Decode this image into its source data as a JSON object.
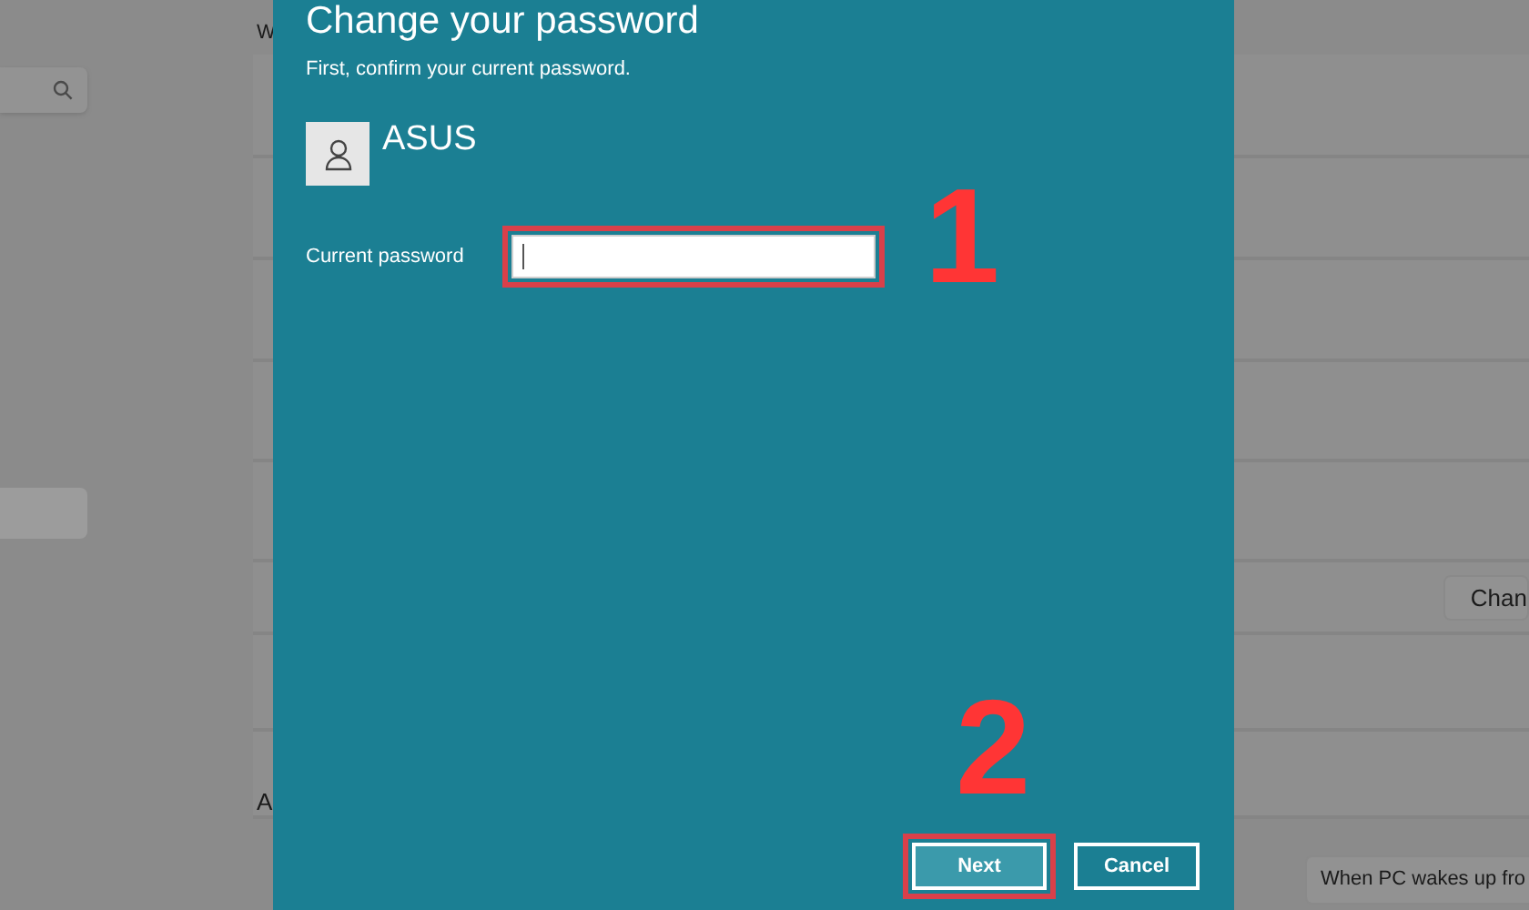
{
  "background": {
    "heading": "W",
    "change_button": "Chan",
    "section_heading": "A",
    "dropdown_value": "When PC wakes up fro"
  },
  "dialog": {
    "title": "Change your password",
    "subtitle": "First, confirm your current password.",
    "account_name": "ASUS",
    "password_label": "Current password",
    "password_step_number": "1",
    "buttons": [
      {
        "label": "Next",
        "kind": "primary",
        "step_number": "2"
      },
      {
        "label": "Cancel",
        "kind": "secondary"
      }
    ]
  }
}
